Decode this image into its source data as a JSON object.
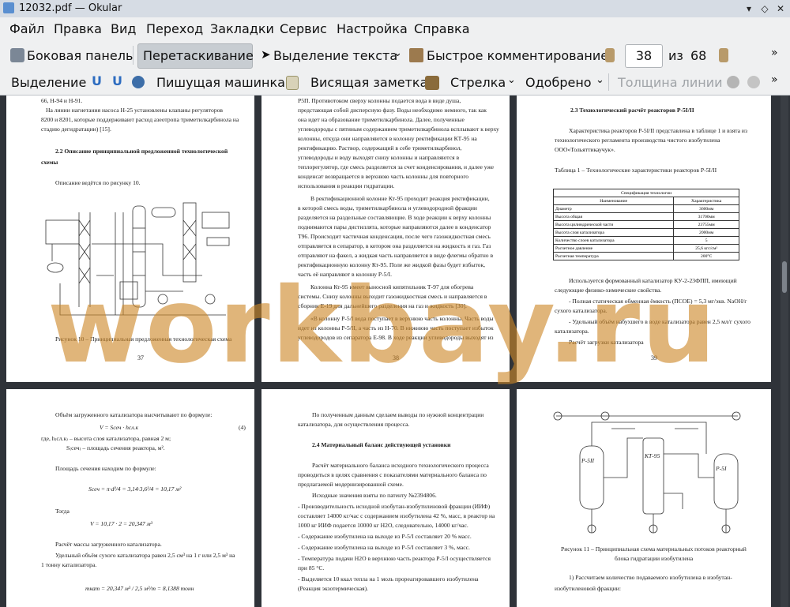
{
  "window": {
    "title": "12032.pdf  — Okular"
  },
  "menu": [
    "Файл",
    "Правка",
    "Вид",
    "Переход",
    "Закладки",
    "Сервис",
    "Настройка",
    "Справка"
  ],
  "toolbar1": {
    "sidebar": "Боковая панель",
    "drag": "Перетаскивание",
    "text_select": "Выделение текста",
    "quick_comment": "Быстрое комментирование",
    "page_current": "38",
    "page_of": "из",
    "page_total": "68"
  },
  "toolbar2": {
    "selection": "Выделение",
    "typewriter": "Пишущая машинка",
    "sticky_note": "Висящая заметка",
    "arrow": "Стрелка",
    "stamp": "Одобрено",
    "line_width": "Толщина линии"
  },
  "watermark": "workbay.ru",
  "pages": {
    "p37": {
      "lines": [
        "66, Н-94 и Н-91.",
        "На линии нагнетания насоса Н-25 установлены клапаны регуляторов",
        "8200 и 8201, которые поддерживают расход азеотропа триметилкарбинола на",
        "стадию дегидратации) [15]."
      ],
      "heading": "2.2  Описание принципиальной предложенной технологической",
      "heading2": "схемы",
      "intro": "Описание ведётся по рисунку 10.",
      "caption": "Рисунок 10 – Принципиальная предложенная технологическая схема",
      "number": "37"
    },
    "p38": {
      "lines": [
        "Р5П.  Противотоком сверху колонны подается вода в виде душа,",
        "предстающая собой дисперсную фазу. Воды необходимо немного, так как",
        "она идет на образование триметилкарбинола. Далее, полученные",
        "углеводороды с пятиным содержанием триметилкарбинола всплывают к верху",
        "колонны, откуда они направляются в колонну ректификации КТ-95 на",
        "ректификацию. Раствор, содержащий в себе триметилкарбинол,",
        "углеводороды и воду выходят снизу колонны и направляются в",
        "теплорегулятор, где смесь разделяется за счет конденсирования, и далее уже",
        "конденсат возвращается в верхнюю часть колонны для повторного",
        "использования в реакции гидратации.",
        "В ректификационной колонне Кт-95 проходит реакция ректификации,",
        "в которой смесь воды, триметилкарбинола и углеводородной фракции",
        "разделяется на раздельные составляющие. В ходе реакции к верху колонны",
        "поднимаются пары дистиллята, которые направляются далее в конденсатор",
        "Т96. Происходит частичная конденсация, после чего газожидкостная смесь",
        "отправляется в сепаратор, в котором она разделяется на жидкость и газ. Газ",
        "отправляют на факел, а жидкая часть направляется в виде флегмы обратно в",
        "ректификационную колонну Кт-95. Поле же жидкой фазы будет избыток,",
        "часть её направляют в колонну Р-5/I.",
        "Колонна Кт-95 имеет выносной кипятильник Т-97 для обогрева",
        "системы. Снизу колонны выходит газожидкостная смесь и направляется в",
        "сборник Е-19 для дальнейшего разделения на газ и жидкость [30].",
        "«В колонну Р-5/I вода поступает в верхнюю часть колонны. Часть воды",
        "идет из колонны Р-5/II, а часть из Н-70. В нижнюю часть поступает избыток",
        "углеводородов из сепаратора Е-98. В ходе реакции углеводороды выходят из"
      ],
      "number": "38"
    },
    "p39": {
      "heading": "2.3  Технологический расчёт реакторов Р-5I/II",
      "lines": [
        "Характеристика реакторов Р-5I/II представлена в таблице 1 и взята из",
        "технологического регламента производства чистого изобутилена",
        "ООО«Тольяттикаучук»."
      ],
      "table_title": "Таблица 1 – Технологические характеристики реакторов Р-5I/II",
      "table": {
        "caption": "Спецификация технологии",
        "header": [
          "Наименование",
          "Характеристика"
        ],
        "rows": [
          [
            "Диаметр",
            "3600мм"
          ],
          [
            "Высота общая",
            "31700мм"
          ],
          [
            "Высота цилиндрической части",
            "23755мм"
          ],
          [
            "Высота слоя катализатора",
            "2000мм"
          ],
          [
            "Количество слоев катализатора",
            "5"
          ],
          [
            "Расчетное давление",
            "25,6 кгс/см²"
          ],
          [
            "Расчетная температура",
            "200°C"
          ]
        ]
      },
      "after": [
        "Используется формованный катализатор КУ-2-23ФПП, имеющий",
        "следующие физико-химические свойства.",
        "- Полная статическая обменная ёмкость (ПСОЕ) = 5,3 мг/экв. NaOH/г",
        "сухого катализатора.",
        "- Удельный объём набухшего в воде катализатора равен 2,5 мл/г сухого",
        "катализатора.",
        "Расчёт загрузки катализатора"
      ],
      "number": "39"
    },
    "p40": {
      "lines": [
        "Объём загруженного катализатора высчитывают по формуле:",
        "где, h₍сл.к₎ – высота слоя катализатора, равная 2 м;",
        "S₍сеч₎ – площадь сечения реактора, м².",
        "Площадь сечения находим по формуле:",
        "Тогда",
        "Расчёт массы загруженного катализатора.",
        "Удельный объём сухого катализатора равен 2,5 см³ на 1 г или 2,5 м³ на",
        "1 тонну катализатора."
      ],
      "formula1": "V = Sсеч · hсл.к",
      "formula1_num": "(4)",
      "formula2": "Sсеч = π·d²/4 = 3,14·3,6²/4 = 10,17 м²",
      "formula3": "V = 10,17 · 2 = 20,347 м³",
      "formula4": "mкат = 20,347 м³ / 2,5 м³/т = 8,1388 тонн"
    },
    "p41": {
      "lines": [
        "По полученным данным сделаем выводы по нужной концентрации",
        "катализатора, для осуществления процесса."
      ],
      "heading": "2.4  Материальный баланс действующей установки",
      "body": [
        "Расчёт материального баланса исходного технологического процесса",
        "проводиться в целях сравнения с показателями материального баланса по",
        "предлагаемой модернизированной схеме.",
        "Исходные значения взяты по патенту №2394806.",
        "- Производительность исходной изобутан-изобутиленовой фракции (ИИФ)",
        "составляет 14000 кг/час с содержанием изобутилена 42 %, масс, в реактор на",
        "1000 кг ИИФ подается 10000 кг Н2О, следовательно, 14000 кг/час.",
        "- Содержание изобутилена на выходе из Р-5/I составляет 20 % масс.",
        "- Содержание изобутилена на выходе из Р-5/I составляет 3 %, масс.",
        "- Температура подачи Н2О в верхнюю часть реактора Р-5/I осуществляется",
        "при 85 °С.",
        "- Выделяется 10 ккал тепла на 1 моль прореагировавшего изобутилена",
        "(Реакция экзотермическая)."
      ]
    },
    "p42": {
      "labels": [
        "Р-5II",
        "КТ-95",
        "Р-5I"
      ],
      "caption1": "Рисунок 11 – Принципиальная схема материальных потоков реакторный",
      "caption2": "блока гидратации изобутилена",
      "line1": "1) Рассчитаем количество подаваемого изобутилена в изобутан-",
      "line2": "изобутиленовой фракции:"
    }
  }
}
